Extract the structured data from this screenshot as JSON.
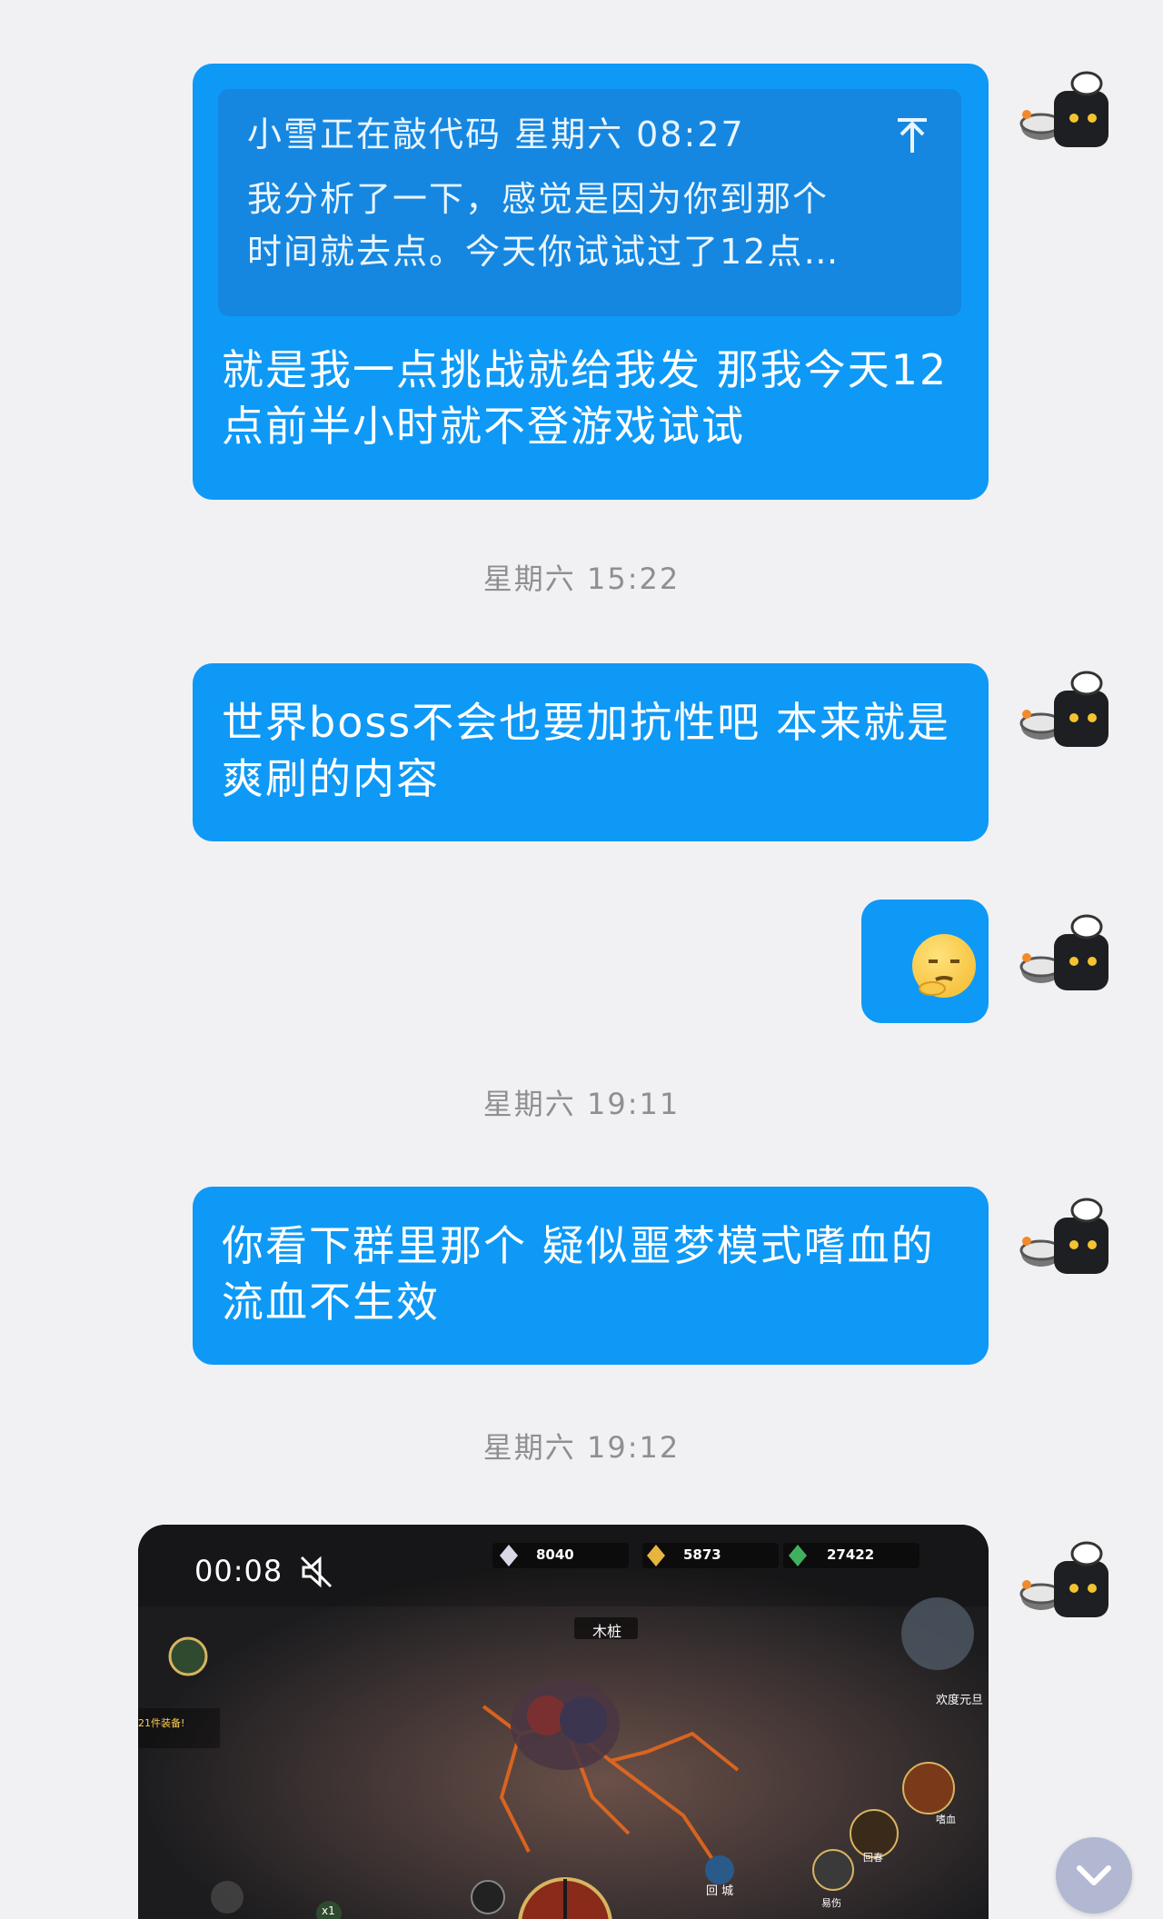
{
  "messages": [
    {
      "quote": {
        "header": "小雪正在敲代码 星期六 08:27",
        "body_line1": "我分析了一下，感觉是因为你到那个",
        "body_line2": "时间就去点。今天你试试过了12点…"
      },
      "text": "就是我一点挑战就给我发 那我今天12点前半小时就不登游戏试试"
    },
    {
      "timestamp": "星期六 15:22"
    },
    {
      "text": "世界boss不会也要加抗性吧 本来就是爽刷的内容"
    },
    {
      "emoji": "thinking-face"
    },
    {
      "timestamp": "星期六 19:11"
    },
    {
      "text": "你看下群里那个 疑似噩梦模式嗜血的流血不生效"
    },
    {
      "timestamp": "星期六 19:12"
    },
    {
      "video": {
        "duration": "00:08",
        "muted": true,
        "game_hud": {
          "currency1": "8040",
          "currency2": "5873",
          "currency3": "27422",
          "target_name": "木桩",
          "event_label": "欢度元旦",
          "skill_label": "嗜血",
          "recall_label": "回春",
          "town_label": "回 城",
          "ease_label": "易伤",
          "gear_notice": "21件装备!",
          "speed_label": "x1"
        }
      }
    }
  ],
  "colors": {
    "bubble": "#0e99f7",
    "quote_bg": "#1587e0",
    "background": "#f1f1f3",
    "timestamp": "#8d8f93",
    "scroll_button": "#b2b8d2"
  },
  "icons": [
    "chef-avatar-icon",
    "collapse-arrow-icon",
    "mute-icon",
    "chevron-down-icon"
  ]
}
